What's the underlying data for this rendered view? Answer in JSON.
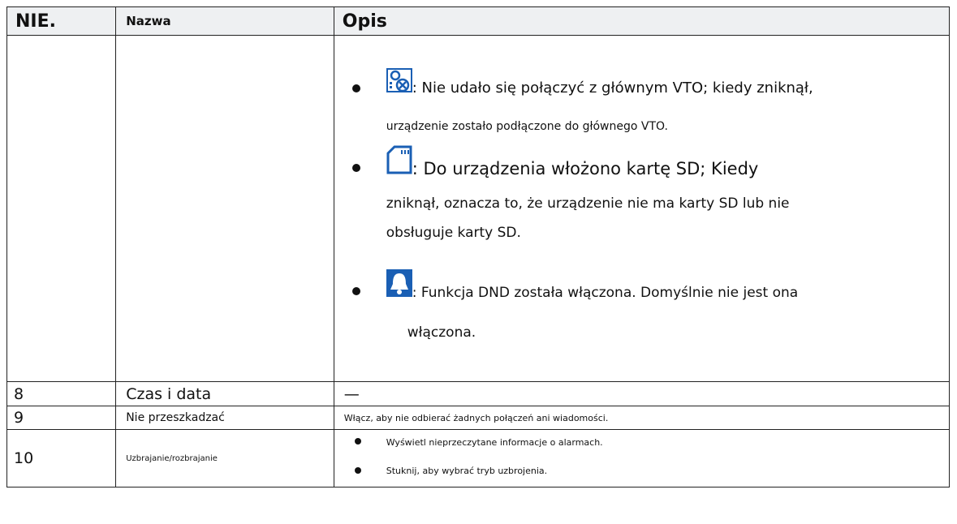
{
  "headers": {
    "no": "NIE.",
    "name": "Nazwa",
    "desc": "Opis"
  },
  "row_icons": {
    "first_col": "",
    "second_col": "",
    "bullets": [
      {
        "icon": "vto-disconnected-icon",
        "line1": ": Nie udało się połączyć z głównym VTO; kiedy zniknął,",
        "line2": "urządzenie zostało podłączone do głównego VTO."
      },
      {
        "icon": "sd-card-icon",
        "line1": ": Do urządzenia włożono kartę SD; Kiedy",
        "line2": "zniknął, oznacza to, że urządzenie nie ma karty SD lub nie",
        "line3": "obsługuje karty SD."
      },
      {
        "icon": "dnd-bell-icon",
        "line1": ": Funkcja DND została włączona. Domyślnie nie jest ona",
        "line2": "włączona."
      }
    ]
  },
  "rows": [
    {
      "no": "8",
      "name": "Czas i data",
      "desc": "—"
    },
    {
      "no": "9",
      "name": "Nie przeszkadzać",
      "desc": "Włącz, aby nie odbierać żadnych połączeń ani wiadomości."
    },
    {
      "no": "10",
      "name": "Uzbrajanie/rozbrajanie",
      "desc_items": [
        "Wyświetl nieprzeczytane informacje o alarmach.",
        "Stuknij, aby wybrać tryb uzbrojenia."
      ]
    }
  ],
  "colors": {
    "header_bg": "#eef0f2",
    "icon_blue": "#1a5fb4"
  }
}
